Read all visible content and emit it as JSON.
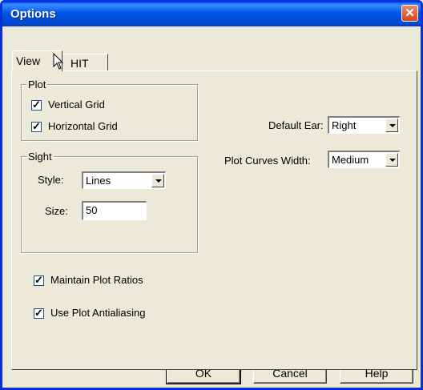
{
  "window": {
    "title": "Options"
  },
  "tabs": [
    {
      "label": "View"
    },
    {
      "label": "HIT"
    }
  ],
  "plot_group": {
    "label": "Plot",
    "vertical_grid": {
      "label": "Vertical Grid",
      "checked": true
    },
    "horizontal_grid": {
      "label": "Horizontal Grid",
      "checked": true
    }
  },
  "sight_group": {
    "label": "Sight",
    "style_label": "Style:",
    "style_value": "Lines",
    "size_label": "Size:",
    "size_value": "50"
  },
  "maintain_ratios": {
    "label": "Maintain Plot Ratios",
    "checked": true
  },
  "antialiasing": {
    "label": "Use Plot Antialiasing",
    "checked": true
  },
  "default_ear": {
    "label": "Default Ear:",
    "value": "Right"
  },
  "curve_width": {
    "label": "Plot Curves Width:",
    "value": "Medium"
  },
  "buttons": {
    "ok": "OK",
    "cancel": "Cancel",
    "help": "Help"
  },
  "colors": {
    "title_bar": "#0054e3",
    "close_button": "#d8431e",
    "dialog_bg": "#ece9d8"
  },
  "icons": {
    "close": "close-icon",
    "cursor": "mouse-cursor-icon"
  }
}
